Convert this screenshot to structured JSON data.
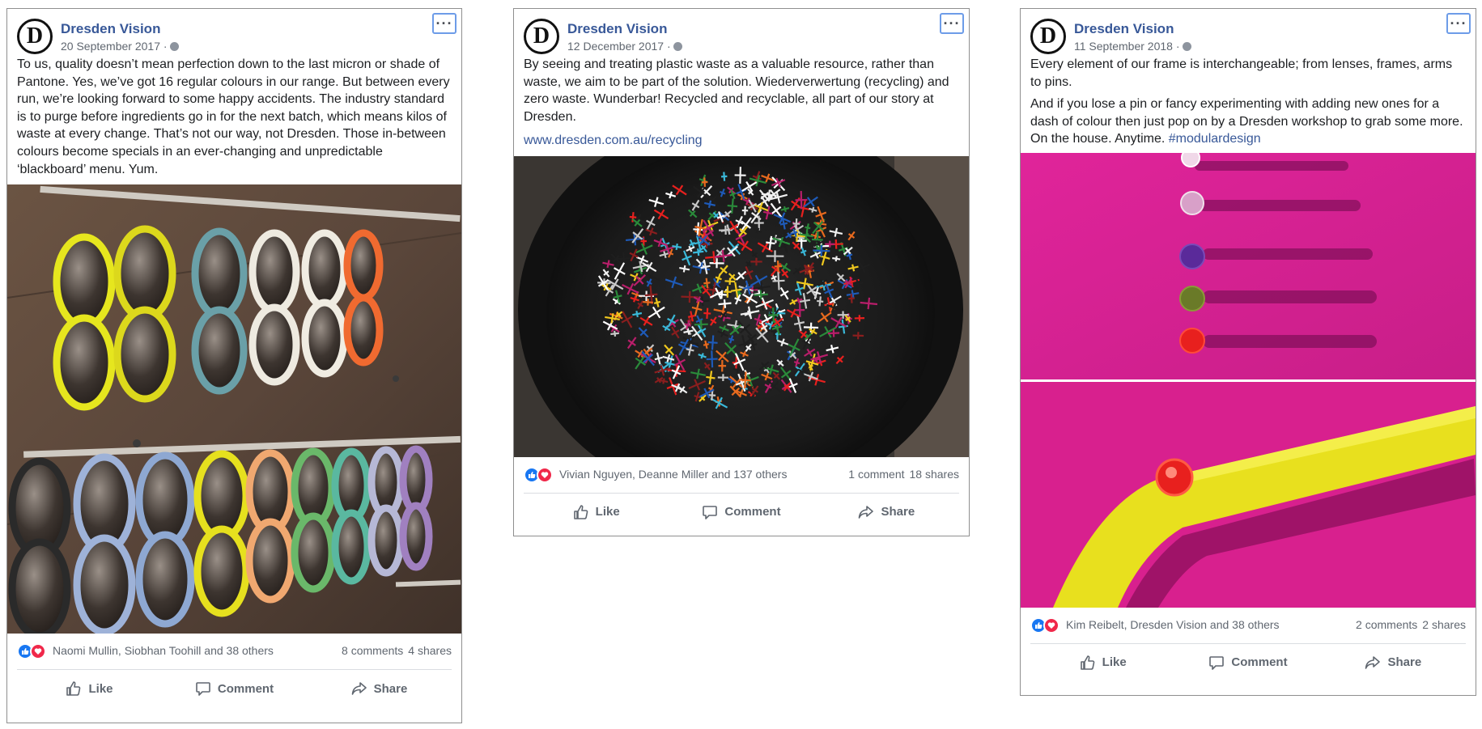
{
  "posts": [
    {
      "author": "Dresden Vision",
      "avatar_letter": "D",
      "date": "20 September 2017 ·",
      "paragraphs": [
        "To us, quality doesn’t mean perfection down to the last micron or shade of Pantone. Yes, we’ve got 16 regular colours in our range. But between every run, we’re looking forward to some happy accidents. The industry standard is to purge before ingredients go in for the next batch, which means kilos of waste at every change. That’s not our way, not Dresden. Those in-between colours become specials in an ever-changing and unpredictable ‘blackboard’ menu. Yum."
      ],
      "reactions_text": "Naomi Mullin, Siobhan Toohill and 38 others",
      "comments": "8 comments",
      "shares": "4 shares",
      "actions": {
        "like": "Like",
        "comment": "Comment",
        "share": "Share"
      }
    },
    {
      "author": "Dresden Vision",
      "avatar_letter": "D",
      "date": "12 December 2017 ·",
      "paragraphs": [
        "By seeing and treating plastic waste as a valuable resource, rather than waste, we aim to be part of the solution. Wiederverwertung (recycling) and zero waste. Wunderbar! Recycled and recyclable, all part of our story at Dresden."
      ],
      "link": "www.dresden.com.au/recycling",
      "reactions_text": "Vivian Nguyen, Deanne Miller and 137 others",
      "comments": "1 comment",
      "shares": "18 shares",
      "actions": {
        "like": "Like",
        "comment": "Comment",
        "share": "Share"
      }
    },
    {
      "author": "Dresden Vision",
      "avatar_letter": "D",
      "date": "11 September 2018 ·",
      "paragraphs": [
        "Every element of our frame is interchangeable; from lenses, frames, arms to pins.",
        "And if you lose a pin or fancy experimenting with adding new ones for a dash of colour then just pop on by a Dresden workshop to grab some more. On the house. Anytime."
      ],
      "hashtag": "#modulardesign",
      "reactions_text": "Kim Reibelt, Dresden Vision and 38 others",
      "comments": "2 comments",
      "shares": "2 shares",
      "actions": {
        "like": "Like",
        "comment": "Comment",
        "share": "Share"
      }
    }
  ],
  "icons": [
    "globe-icon",
    "more-options-icon",
    "like-reaction-icon",
    "love-reaction-icon",
    "thumbs-up-icon",
    "comment-icon",
    "share-icon"
  ],
  "colors": {
    "link": "#385898",
    "like_blue": "#1877f2",
    "love_red": "#f0284a",
    "action_grey": "#606770",
    "focus_outline": "#6d9ce8"
  }
}
